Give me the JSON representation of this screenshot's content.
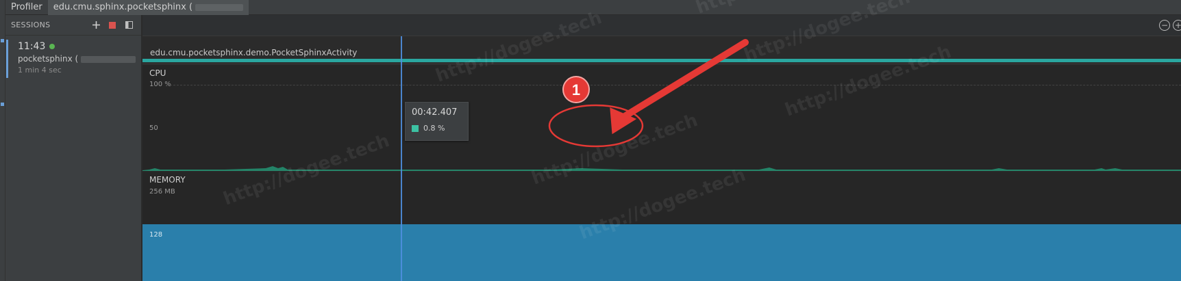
{
  "tabs": [
    {
      "label": "Profiler"
    },
    {
      "label": "edu.cmu.sphinx.pocketsphinx ("
    }
  ],
  "sessions": {
    "header": "SESSIONS",
    "add_icon": "plus-icon",
    "stop_icon": "stop-icon",
    "layout_icon": "panel-layout-icon",
    "item": {
      "time": "11:43",
      "name": "pocketsphinx (",
      "duration": "1 min 4 sec"
    }
  },
  "toolbar": {
    "zoom_out": "−",
    "zoom_in": "+"
  },
  "activity": {
    "name": "edu.cmu.pocketsphinx.demo.PocketSphinxActivity"
  },
  "cpu": {
    "title": "CPU",
    "axis_top": "100 %",
    "axis_mid": "50"
  },
  "memory": {
    "title": "MEMORY",
    "axis_top": "256 MB",
    "axis_mid": "128"
  },
  "tooltip": {
    "time": "00:42.407",
    "value": "0.8 %"
  },
  "annotation": {
    "number": "1"
  },
  "watermark": "http://dogee.tech",
  "colors": {
    "accent": "#2aa7a0",
    "cpu_series": "#3cc2a3",
    "memory_fill": "#2a7fab",
    "cursor": "#4f8fe0",
    "annotation": "#e53935"
  }
}
